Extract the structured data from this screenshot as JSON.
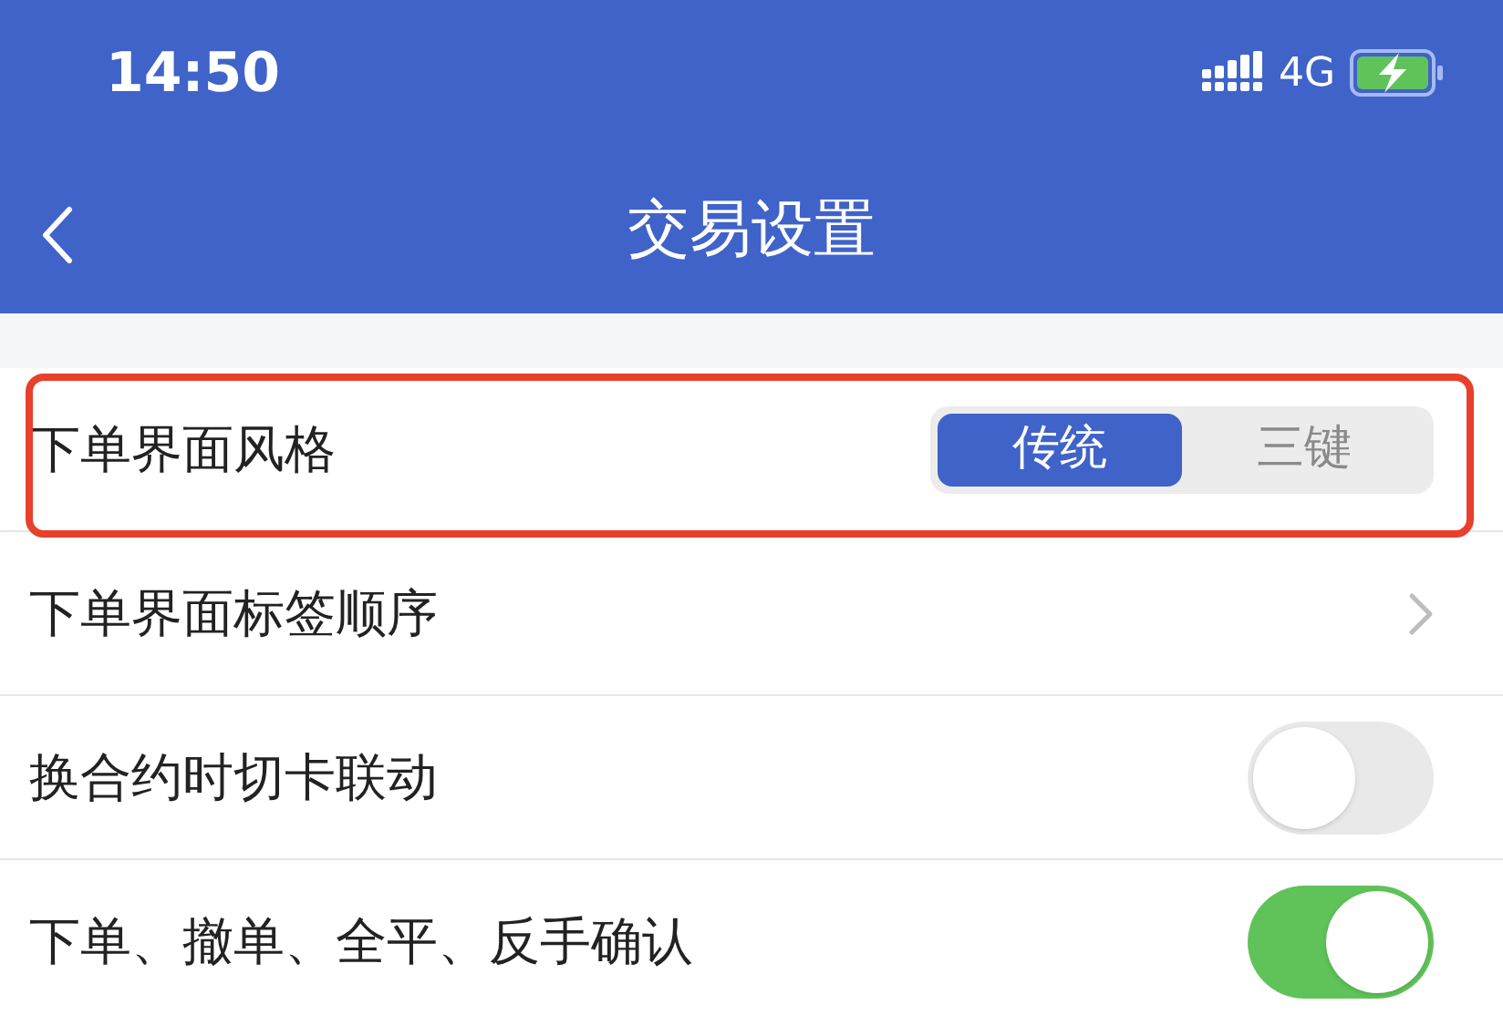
{
  "status_bar": {
    "time": "14:50",
    "network": "4G",
    "charging": true
  },
  "nav": {
    "title": "交易设置"
  },
  "rows": [
    {
      "kind": "segmented",
      "label": "下单界面风格",
      "highlighted": true,
      "options": [
        {
          "label": "传统",
          "selected": true
        },
        {
          "label": "三键",
          "selected": false
        }
      ]
    },
    {
      "kind": "link",
      "label": "下单界面标签顺序",
      "highlighted": false
    },
    {
      "kind": "toggle",
      "label": "换合约时切卡联动",
      "on": false,
      "highlighted": false
    },
    {
      "kind": "toggle",
      "label": "下单、撤单、全平、反手确认",
      "on": true,
      "highlighted": false
    }
  ]
}
